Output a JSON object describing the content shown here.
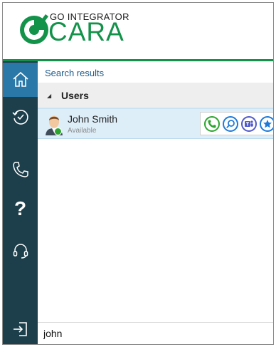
{
  "app": {
    "logo_top": "GO INTEGRATOR",
    "logo_main": "CARA",
    "brand_color": "#13924a"
  },
  "sidebar": {
    "items": [
      {
        "icon": "home-icon",
        "active": true
      },
      {
        "icon": "history-icon",
        "active": false
      },
      {
        "icon": "phone-icon",
        "active": false
      },
      {
        "icon": "help-icon",
        "label": "?",
        "active": false
      },
      {
        "icon": "headset-icon",
        "active": false
      },
      {
        "icon": "sign-out-icon",
        "active": false
      }
    ],
    "bg_color": "#1d3e4b",
    "active_color": "#2a78a8"
  },
  "main": {
    "title": "Search results",
    "group": {
      "label": "Users",
      "expanded": true
    },
    "users": [
      {
        "name": "John Smith",
        "status": "Available",
        "status_color": "#2ca52f",
        "actions": [
          "call-icon",
          "search-contact-icon",
          "teams-icon",
          "favorite-icon"
        ]
      }
    ]
  },
  "search": {
    "value": "john"
  }
}
